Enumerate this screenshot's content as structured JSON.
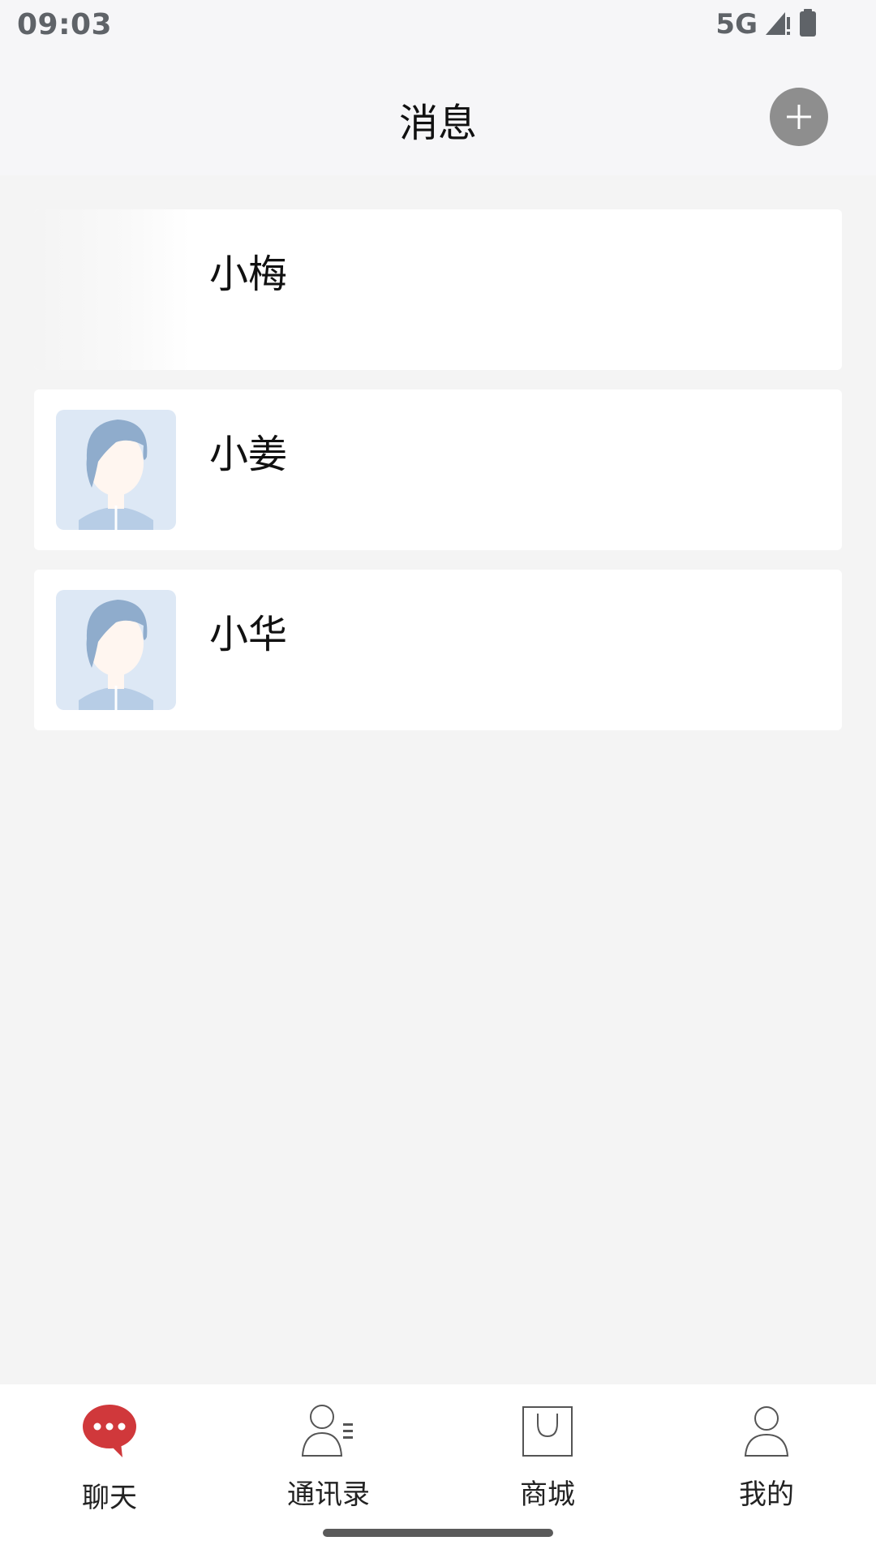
{
  "status_bar": {
    "time": "09:03",
    "network": "5G",
    "signal_icon": "signal-icon",
    "battery_icon": "battery-icon"
  },
  "header": {
    "title": "消息",
    "add_icon": "plus-icon"
  },
  "conversations": [
    {
      "name": "小梅",
      "avatar": "blank-avatar"
    },
    {
      "name": "小姜",
      "avatar": "default-user-avatar"
    },
    {
      "name": "小华",
      "avatar": "default-user-avatar"
    }
  ],
  "tabs": [
    {
      "label": "聊天",
      "icon": "chat-bubble-icon",
      "active": true
    },
    {
      "label": "通讯录",
      "icon": "contacts-icon",
      "active": false
    },
    {
      "label": "商城",
      "icon": "shopping-bag-icon",
      "active": false
    },
    {
      "label": "我的",
      "icon": "profile-icon",
      "active": false
    }
  ],
  "colors": {
    "accent": "#d0383b",
    "header_bg": "#f6f6f8",
    "page_bg": "#f4f4f4",
    "add_button": "#8e8e8e"
  }
}
